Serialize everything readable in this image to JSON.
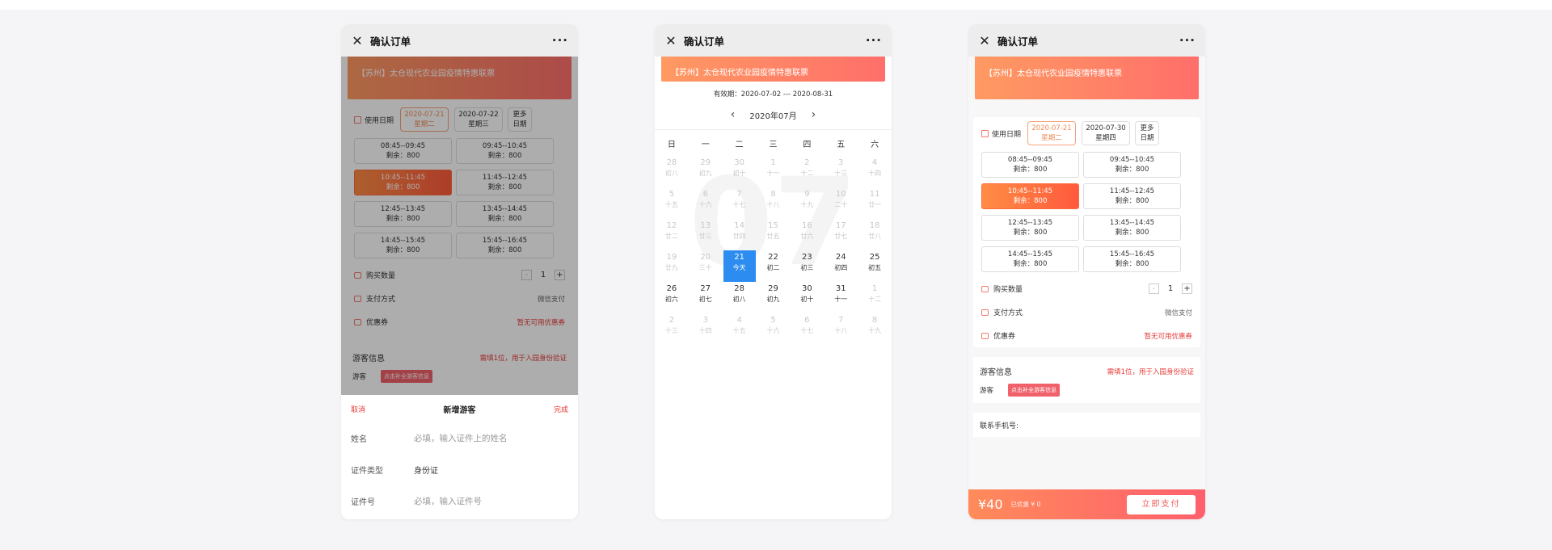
{
  "nav": {
    "title": "确认订单",
    "more": "···",
    "close": "✕"
  },
  "banner": "【苏州】太仓现代农业园疫情特惠联票",
  "order": {
    "date_label": "使用日期",
    "more_dates": [
      "更多",
      "日期"
    ],
    "qty_label": "购买数量",
    "qty": "1",
    "minus": "-",
    "plus": "+",
    "pay_method_label": "支付方式",
    "pay_method_value": "微信支付",
    "coupon_label": "优惠券",
    "coupon_value": "暂无可用优惠券",
    "slots": [
      {
        "time": "08:45--09:45",
        "remain": "剩余：800"
      },
      {
        "time": "09:45--10:45",
        "remain": "剩余：800"
      },
      {
        "time": "10:45--11:45",
        "remain": "剩余：800"
      },
      {
        "time": "11:45--12:45",
        "remain": "剩余：800"
      },
      {
        "time": "12:45--13:45",
        "remain": "剩余：800"
      },
      {
        "time": "13:45--14:45",
        "remain": "剩余：800"
      },
      {
        "time": "14:45--15:45",
        "remain": "剩余：800"
      },
      {
        "time": "15:45--16:45",
        "remain": "剩余：800"
      }
    ],
    "selected_slot": 2
  },
  "screen1": {
    "dates": [
      {
        "date": "2020-07-21",
        "week": "星期二"
      },
      {
        "date": "2020-07-22",
        "week": "星期三"
      }
    ]
  },
  "screen3": {
    "dates": [
      {
        "date": "2020-07-21",
        "week": "星期二"
      },
      {
        "date": "2020-07-30",
        "week": "星期四"
      }
    ]
  },
  "visitor": {
    "title": "游客信息",
    "hint": "需填1位，用于入园身份验证",
    "label": "游客",
    "button": "点击补全游客信息"
  },
  "phone_label": "联系手机号:",
  "sheet": {
    "cancel": "取消",
    "title": "新增游客",
    "done": "完成",
    "name_label": "姓名",
    "name_placeholder": "必填，输入证件上的姓名",
    "idtype_label": "证件类型",
    "idtype_value": "身份证",
    "idnum_label": "证件号",
    "idnum_placeholder": "必填，输入证件号"
  },
  "calendar": {
    "validity": "有效期：2020-07-02 --- 2020-08-31",
    "month": "2020年07月",
    "prev": "‹",
    "next": "›",
    "watermark": "07",
    "weekdays": [
      "日",
      "一",
      "二",
      "三",
      "四",
      "五",
      "六"
    ],
    "days": [
      {
        "n": "28",
        "s": "初八",
        "k": "dim"
      },
      {
        "n": "29",
        "s": "初九",
        "k": "dim"
      },
      {
        "n": "30",
        "s": "初十",
        "k": "dim"
      },
      {
        "n": "1",
        "s": "十一",
        "k": "dim"
      },
      {
        "n": "2",
        "s": "十二",
        "k": "dim"
      },
      {
        "n": "3",
        "s": "十三",
        "k": "dim"
      },
      {
        "n": "4",
        "s": "十四",
        "k": "dim"
      },
      {
        "n": "5",
        "s": "十五",
        "k": "dim"
      },
      {
        "n": "6",
        "s": "十六",
        "k": "dim"
      },
      {
        "n": "7",
        "s": "十七",
        "k": "dim"
      },
      {
        "n": "8",
        "s": "十八",
        "k": "dim"
      },
      {
        "n": "9",
        "s": "十九",
        "k": "dim"
      },
      {
        "n": "10",
        "s": "二十",
        "k": "dim"
      },
      {
        "n": "11",
        "s": "廿一",
        "k": "dim"
      },
      {
        "n": "12",
        "s": "廿二",
        "k": "dim"
      },
      {
        "n": "13",
        "s": "廿三",
        "k": "dim"
      },
      {
        "n": "14",
        "s": "廿四",
        "k": "dim"
      },
      {
        "n": "15",
        "s": "廿五",
        "k": "dim"
      },
      {
        "n": "16",
        "s": "廿六",
        "k": "dim"
      },
      {
        "n": "17",
        "s": "廿七",
        "k": "dim"
      },
      {
        "n": "18",
        "s": "廿八",
        "k": "dim"
      },
      {
        "n": "19",
        "s": "廿九",
        "k": "dim"
      },
      {
        "n": "20",
        "s": "三十",
        "k": "dim"
      },
      {
        "n": "21",
        "s": "今天",
        "k": "today"
      },
      {
        "n": "22",
        "s": "初二",
        "k": "act"
      },
      {
        "n": "23",
        "s": "初三",
        "k": "act"
      },
      {
        "n": "24",
        "s": "初四",
        "k": "act"
      },
      {
        "n": "25",
        "s": "初五",
        "k": "act"
      },
      {
        "n": "26",
        "s": "初六",
        "k": "act"
      },
      {
        "n": "27",
        "s": "初七",
        "k": "act"
      },
      {
        "n": "28",
        "s": "初八",
        "k": "act"
      },
      {
        "n": "29",
        "s": "初九",
        "k": "act"
      },
      {
        "n": "30",
        "s": "初十",
        "k": "act"
      },
      {
        "n": "31",
        "s": "十一",
        "k": "act"
      },
      {
        "n": "1",
        "s": "十二",
        "k": "next"
      },
      {
        "n": "2",
        "s": "十三",
        "k": "next"
      },
      {
        "n": "3",
        "s": "十四",
        "k": "next"
      },
      {
        "n": "4",
        "s": "十五",
        "k": "next"
      },
      {
        "n": "5",
        "s": "十六",
        "k": "next"
      },
      {
        "n": "6",
        "s": "十七",
        "k": "next"
      },
      {
        "n": "7",
        "s": "十八",
        "k": "next"
      },
      {
        "n": "8",
        "s": "十九",
        "k": "next"
      }
    ]
  },
  "pay": {
    "price": "¥40",
    "saved": "已优惠 ¥ 0",
    "button": "立即支付"
  },
  "colors": {
    "accent": "#ff6a3c",
    "today": "#2d8cf0",
    "warn": "#e53935"
  }
}
